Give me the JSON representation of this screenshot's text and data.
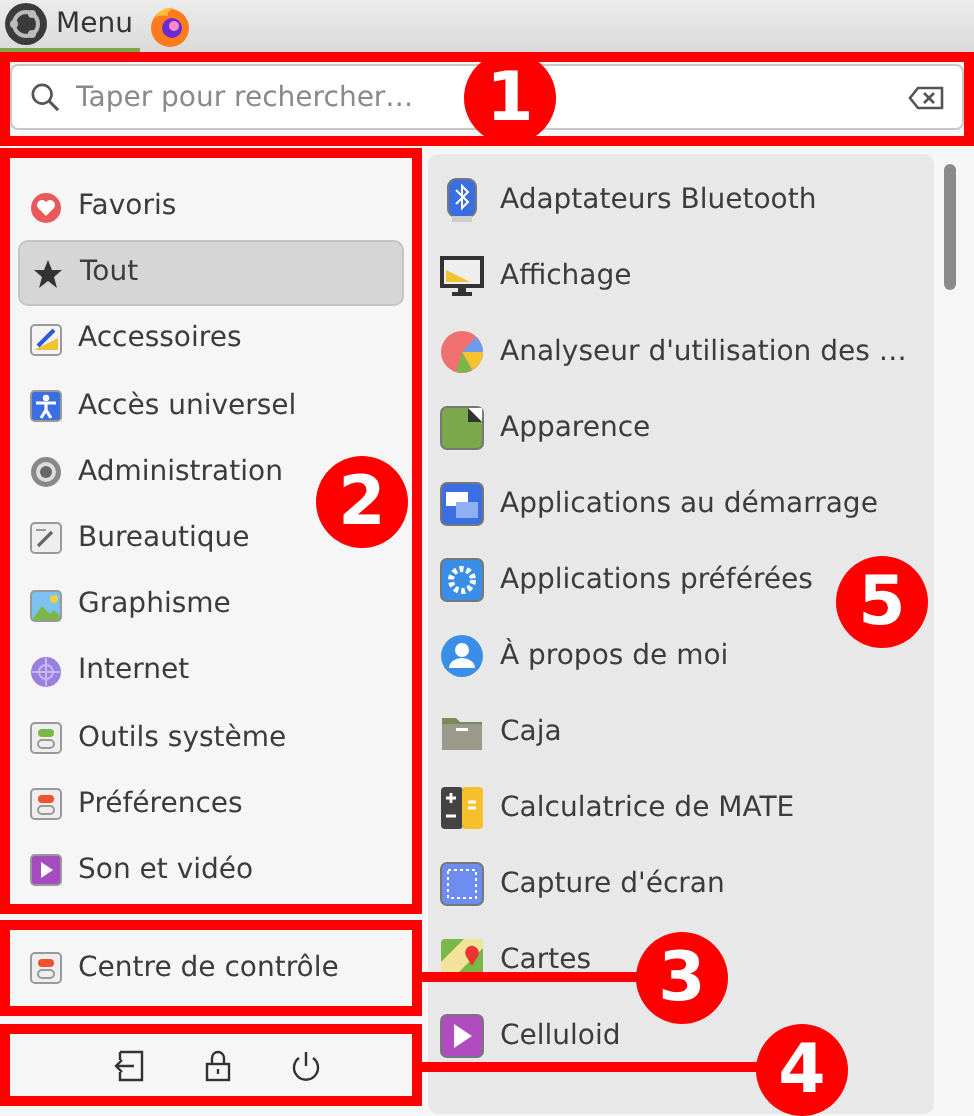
{
  "panel": {
    "menu_label": "Menu"
  },
  "search": {
    "placeholder": "Taper pour rechercher…"
  },
  "categories": [
    {
      "label": "Favoris",
      "selected": false
    },
    {
      "label": "Tout",
      "selected": true
    },
    {
      "label": "Accessoires",
      "selected": false
    },
    {
      "label": "Accès universel",
      "selected": false
    },
    {
      "label": "Administration",
      "selected": false
    },
    {
      "label": "Bureautique",
      "selected": false
    },
    {
      "label": "Graphisme",
      "selected": false
    },
    {
      "label": "Internet",
      "selected": false
    },
    {
      "label": "Outils système",
      "selected": false
    },
    {
      "label": "Préférences",
      "selected": false
    },
    {
      "label": "Son et vidéo",
      "selected": false
    }
  ],
  "control_center": {
    "label": "Centre de contrôle"
  },
  "apps": [
    {
      "label": "Adaptateurs Bluetooth"
    },
    {
      "label": "Affichage"
    },
    {
      "label": "Analyseur d'utilisation des …"
    },
    {
      "label": "Apparence"
    },
    {
      "label": "Applications au démarrage"
    },
    {
      "label": "Applications préférées"
    },
    {
      "label": "À propos de moi"
    },
    {
      "label": "Caja"
    },
    {
      "label": "Calculatrice de MATE"
    },
    {
      "label": "Capture d'écran"
    },
    {
      "label": "Cartes"
    },
    {
      "label": "Celluloid"
    }
  ],
  "callouts": [
    {
      "number": "1"
    },
    {
      "number": "2"
    },
    {
      "number": "3"
    },
    {
      "number": "4"
    },
    {
      "number": "5"
    }
  ]
}
